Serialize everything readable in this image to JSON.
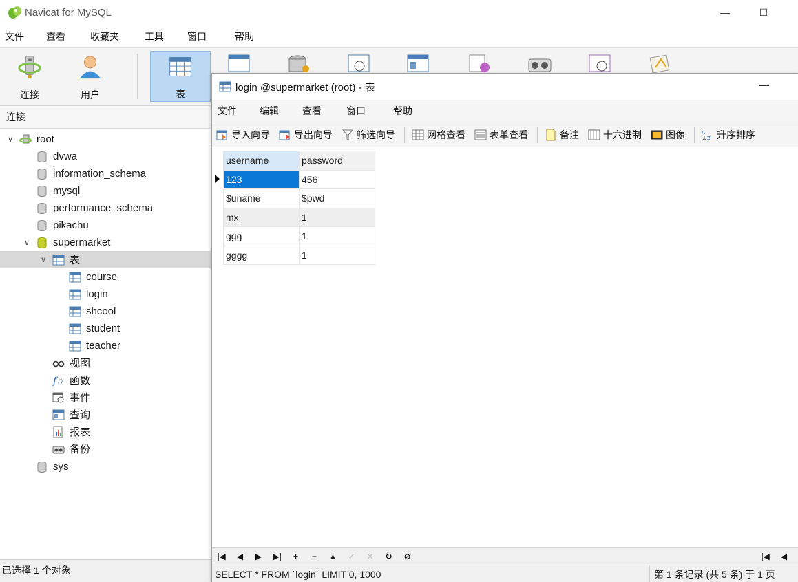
{
  "app": {
    "title": "Navicat for MySQL",
    "minimize": "—",
    "maximize": "☐"
  },
  "main_menu": [
    "文件",
    "查看",
    "收藏夹",
    "工具",
    "窗口",
    "帮助"
  ],
  "toolbar": [
    {
      "label": "连接",
      "icon": "connection-icon"
    },
    {
      "label": "用户",
      "icon": "user-icon"
    },
    {
      "label": "表",
      "icon": "table-icon",
      "active": true
    }
  ],
  "left_pane": {
    "header": "连接",
    "tree": [
      {
        "label": "root",
        "icon": "server-icon",
        "expanded": true
      },
      {
        "label": "dvwa",
        "icon": "database-icon"
      },
      {
        "label": "information_schema",
        "icon": "database-icon"
      },
      {
        "label": "mysql",
        "icon": "database-icon"
      },
      {
        "label": "performance_schema",
        "icon": "database-icon"
      },
      {
        "label": "pikachu",
        "icon": "database-icon"
      },
      {
        "label": "supermarket",
        "icon": "database-open-icon",
        "expanded": true
      },
      {
        "label": "表",
        "icon": "table-icon",
        "expanded": true,
        "selected": true
      },
      {
        "label": "course",
        "icon": "table-icon"
      },
      {
        "label": "login",
        "icon": "table-icon"
      },
      {
        "label": "shcool",
        "icon": "table-icon"
      },
      {
        "label": "student",
        "icon": "table-icon"
      },
      {
        "label": "teacher",
        "icon": "table-icon"
      },
      {
        "label": "视图",
        "icon": "view-icon"
      },
      {
        "label": "函数",
        "icon": "function-icon"
      },
      {
        "label": "事件",
        "icon": "event-icon"
      },
      {
        "label": "查询",
        "icon": "query-icon"
      },
      {
        "label": "报表",
        "icon": "report-icon"
      },
      {
        "label": "备份",
        "icon": "backup-icon"
      },
      {
        "label": "sys",
        "icon": "database-icon"
      }
    ],
    "status": "已选择 1 个对象"
  },
  "child_window": {
    "title": "login @supermarket (root) - 表",
    "minimize": "—",
    "menu": [
      "文件",
      "编辑",
      "查看",
      "窗口",
      "帮助"
    ],
    "toolbar": {
      "import": "导入向导",
      "export": "导出向导",
      "filter": "筛选向导",
      "grid_view": "网格查看",
      "form_view": "表单查看",
      "memo": "备注",
      "hex": "十六进制",
      "image": "图像",
      "sort": "升序排序"
    },
    "columns": [
      "username",
      "password"
    ],
    "rows": [
      [
        "123",
        "456"
      ],
      [
        "$uname",
        "$pwd"
      ],
      [
        "mx",
        "1"
      ],
      [
        "ggg",
        "1"
      ],
      [
        "gggg",
        "1"
      ]
    ],
    "nav": {
      "first": "|◀",
      "prev": "◀",
      "next": "▶",
      "last": "▶|",
      "add": "+",
      "delete": "−",
      "up": "▲",
      "apply": "✓",
      "cancel": "✕",
      "refresh": "↻",
      "stop": "⊘",
      "page_first": "|◀",
      "page_prev": "◀"
    },
    "sql": "SELECT * FROM `login` LIMIT 0, 1000",
    "record_info": "第 1 条记录 (共 5 条) 于 1 页"
  },
  "colors": {
    "selection": "#0a78d7",
    "active_tool": "#bcd9f4"
  }
}
